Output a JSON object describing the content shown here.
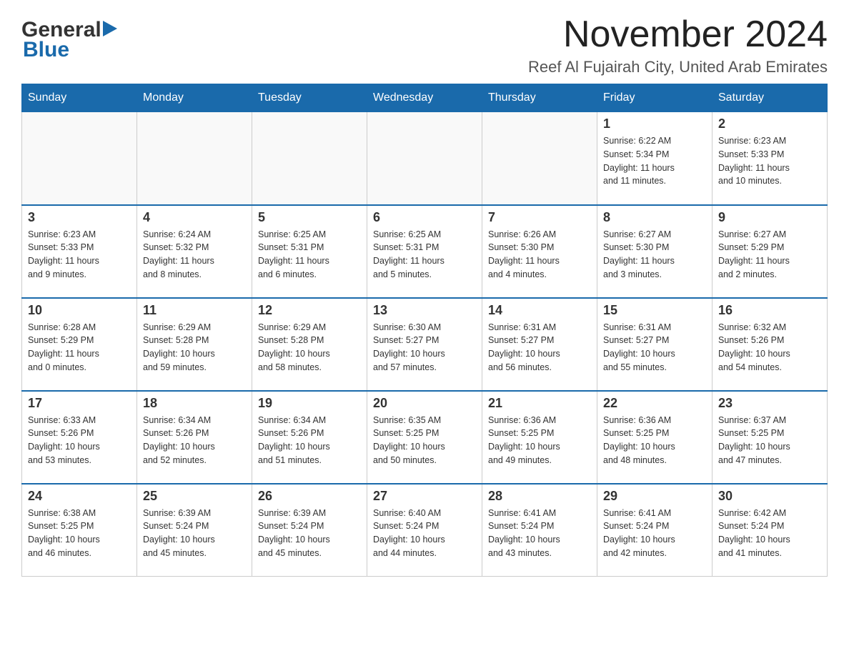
{
  "logo": {
    "general": "General",
    "blue": "Blue"
  },
  "header": {
    "month_year": "November 2024",
    "location": "Reef Al Fujairah City, United Arab Emirates"
  },
  "weekdays": [
    "Sunday",
    "Monday",
    "Tuesday",
    "Wednesday",
    "Thursday",
    "Friday",
    "Saturday"
  ],
  "weeks": [
    {
      "days": [
        {
          "date": "",
          "info": ""
        },
        {
          "date": "",
          "info": ""
        },
        {
          "date": "",
          "info": ""
        },
        {
          "date": "",
          "info": ""
        },
        {
          "date": "",
          "info": ""
        },
        {
          "date": "1",
          "info": "Sunrise: 6:22 AM\nSunset: 5:34 PM\nDaylight: 11 hours\nand 11 minutes."
        },
        {
          "date": "2",
          "info": "Sunrise: 6:23 AM\nSunset: 5:33 PM\nDaylight: 11 hours\nand 10 minutes."
        }
      ]
    },
    {
      "days": [
        {
          "date": "3",
          "info": "Sunrise: 6:23 AM\nSunset: 5:33 PM\nDaylight: 11 hours\nand 9 minutes."
        },
        {
          "date": "4",
          "info": "Sunrise: 6:24 AM\nSunset: 5:32 PM\nDaylight: 11 hours\nand 8 minutes."
        },
        {
          "date": "5",
          "info": "Sunrise: 6:25 AM\nSunset: 5:31 PM\nDaylight: 11 hours\nand 6 minutes."
        },
        {
          "date": "6",
          "info": "Sunrise: 6:25 AM\nSunset: 5:31 PM\nDaylight: 11 hours\nand 5 minutes."
        },
        {
          "date": "7",
          "info": "Sunrise: 6:26 AM\nSunset: 5:30 PM\nDaylight: 11 hours\nand 4 minutes."
        },
        {
          "date": "8",
          "info": "Sunrise: 6:27 AM\nSunset: 5:30 PM\nDaylight: 11 hours\nand 3 minutes."
        },
        {
          "date": "9",
          "info": "Sunrise: 6:27 AM\nSunset: 5:29 PM\nDaylight: 11 hours\nand 2 minutes."
        }
      ]
    },
    {
      "days": [
        {
          "date": "10",
          "info": "Sunrise: 6:28 AM\nSunset: 5:29 PM\nDaylight: 11 hours\nand 0 minutes."
        },
        {
          "date": "11",
          "info": "Sunrise: 6:29 AM\nSunset: 5:28 PM\nDaylight: 10 hours\nand 59 minutes."
        },
        {
          "date": "12",
          "info": "Sunrise: 6:29 AM\nSunset: 5:28 PM\nDaylight: 10 hours\nand 58 minutes."
        },
        {
          "date": "13",
          "info": "Sunrise: 6:30 AM\nSunset: 5:27 PM\nDaylight: 10 hours\nand 57 minutes."
        },
        {
          "date": "14",
          "info": "Sunrise: 6:31 AM\nSunset: 5:27 PM\nDaylight: 10 hours\nand 56 minutes."
        },
        {
          "date": "15",
          "info": "Sunrise: 6:31 AM\nSunset: 5:27 PM\nDaylight: 10 hours\nand 55 minutes."
        },
        {
          "date": "16",
          "info": "Sunrise: 6:32 AM\nSunset: 5:26 PM\nDaylight: 10 hours\nand 54 minutes."
        }
      ]
    },
    {
      "days": [
        {
          "date": "17",
          "info": "Sunrise: 6:33 AM\nSunset: 5:26 PM\nDaylight: 10 hours\nand 53 minutes."
        },
        {
          "date": "18",
          "info": "Sunrise: 6:34 AM\nSunset: 5:26 PM\nDaylight: 10 hours\nand 52 minutes."
        },
        {
          "date": "19",
          "info": "Sunrise: 6:34 AM\nSunset: 5:26 PM\nDaylight: 10 hours\nand 51 minutes."
        },
        {
          "date": "20",
          "info": "Sunrise: 6:35 AM\nSunset: 5:25 PM\nDaylight: 10 hours\nand 50 minutes."
        },
        {
          "date": "21",
          "info": "Sunrise: 6:36 AM\nSunset: 5:25 PM\nDaylight: 10 hours\nand 49 minutes."
        },
        {
          "date": "22",
          "info": "Sunrise: 6:36 AM\nSunset: 5:25 PM\nDaylight: 10 hours\nand 48 minutes."
        },
        {
          "date": "23",
          "info": "Sunrise: 6:37 AM\nSunset: 5:25 PM\nDaylight: 10 hours\nand 47 minutes."
        }
      ]
    },
    {
      "days": [
        {
          "date": "24",
          "info": "Sunrise: 6:38 AM\nSunset: 5:25 PM\nDaylight: 10 hours\nand 46 minutes."
        },
        {
          "date": "25",
          "info": "Sunrise: 6:39 AM\nSunset: 5:24 PM\nDaylight: 10 hours\nand 45 minutes."
        },
        {
          "date": "26",
          "info": "Sunrise: 6:39 AM\nSunset: 5:24 PM\nDaylight: 10 hours\nand 45 minutes."
        },
        {
          "date": "27",
          "info": "Sunrise: 6:40 AM\nSunset: 5:24 PM\nDaylight: 10 hours\nand 44 minutes."
        },
        {
          "date": "28",
          "info": "Sunrise: 6:41 AM\nSunset: 5:24 PM\nDaylight: 10 hours\nand 43 minutes."
        },
        {
          "date": "29",
          "info": "Sunrise: 6:41 AM\nSunset: 5:24 PM\nDaylight: 10 hours\nand 42 minutes."
        },
        {
          "date": "30",
          "info": "Sunrise: 6:42 AM\nSunset: 5:24 PM\nDaylight: 10 hours\nand 41 minutes."
        }
      ]
    }
  ]
}
